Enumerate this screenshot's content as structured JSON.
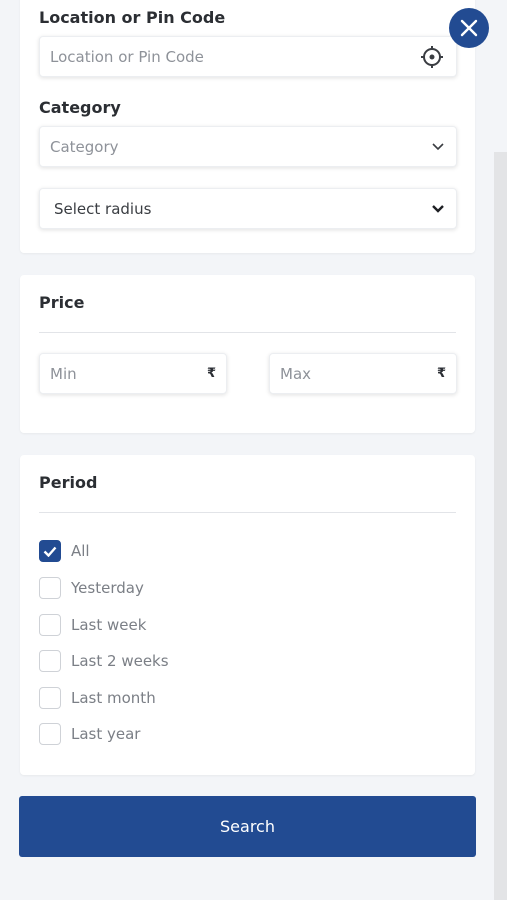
{
  "location": {
    "label": "Location or Pin Code",
    "placeholder": "Location or Pin Code",
    "icon": "crosshair-icon"
  },
  "category": {
    "label": "Category",
    "placeholder": "Category",
    "icon": "chevron-down-icon"
  },
  "radius": {
    "value": "Select radius",
    "icon": "chevron-down-icon"
  },
  "price": {
    "label": "Price",
    "min_placeholder": "Min",
    "max_placeholder": "Max",
    "currency_symbol": "₹"
  },
  "period": {
    "label": "Period",
    "options": [
      {
        "label": "All",
        "checked": true
      },
      {
        "label": "Yesterday",
        "checked": false
      },
      {
        "label": "Last week",
        "checked": false
      },
      {
        "label": "Last 2 weeks",
        "checked": false
      },
      {
        "label": "Last month",
        "checked": false
      },
      {
        "label": "Last year",
        "checked": false
      }
    ]
  },
  "search_button": {
    "label": "Search"
  },
  "close_button": {
    "icon": "close-icon"
  },
  "colors": {
    "accent": "#224b92",
    "background": "#f3f5f8"
  }
}
